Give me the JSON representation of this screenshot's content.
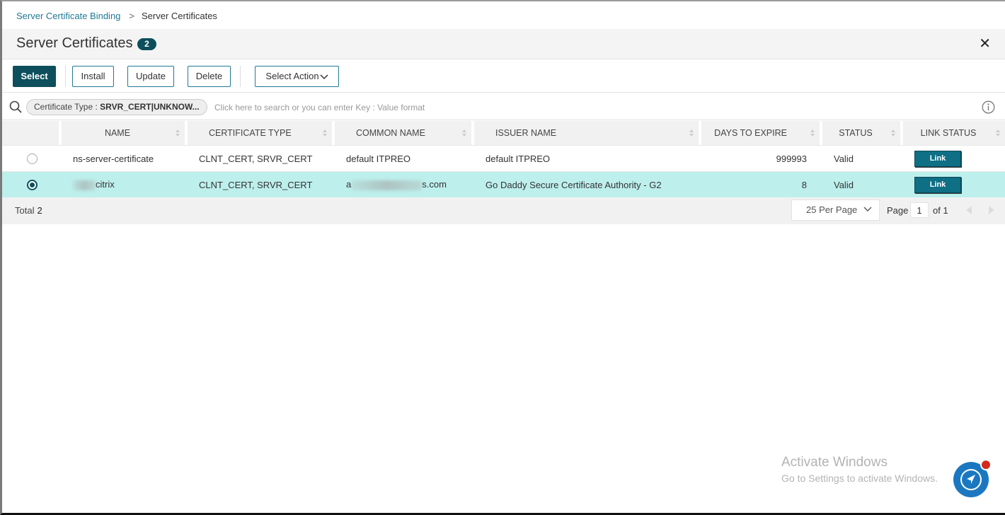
{
  "breadcrumb": {
    "parent": "Server Certificate Binding",
    "current": "Server Certificates"
  },
  "header": {
    "title": "Server Certificates",
    "count": "2",
    "close_icon": "close-icon"
  },
  "toolbar": {
    "select_label": "Select",
    "install_label": "Install",
    "update_label": "Update",
    "delete_label": "Delete",
    "select_action_label": "Select Action"
  },
  "search": {
    "chip_key": "Certificate Type : ",
    "chip_value": "SRVR_CERT|UNKNOW...",
    "placeholder": "Click here to search or you can enter Key : Value format"
  },
  "table": {
    "columns": [
      "",
      "NAME",
      "CERTIFICATE TYPE",
      "COMMON NAME",
      "ISSUER NAME",
      "DAYS TO EXPIRE",
      "STATUS",
      "LINK STATUS"
    ],
    "rows": [
      {
        "selected": false,
        "name": "ns-server-certificate",
        "name_redacted": false,
        "certificate_type": "CLNT_CERT, SRVR_CERT",
        "common_name": "default ITPREO",
        "issuer_name": "default ITPREO",
        "days_to_expire": "999993",
        "status": "Valid",
        "link_label": "Link"
      },
      {
        "selected": true,
        "name_suffix": "citrix",
        "common_name_prefix": "a",
        "common_name_suffix": "s.com",
        "certificate_type": "CLNT_CERT, SRVR_CERT",
        "issuer_name": "Go Daddy Secure Certificate Authority - G2",
        "days_to_expire": "8",
        "status": "Valid",
        "link_label": "Link"
      }
    ]
  },
  "footer": {
    "total_label": "Total",
    "total_value": "2",
    "per_page": "25 Per Page",
    "page_label": "Page",
    "page_value": "1",
    "page_of": "of 1"
  },
  "watermark": {
    "line1": "Activate Windows",
    "line2": "Go to Settings to activate Windows."
  },
  "colors": {
    "accent": "#0d4f5c",
    "link_text": "#1f7a94",
    "selected_row": "#bdefec",
    "link_button": "#0e6f85",
    "fab": "#1b78c0",
    "notification_dot": "#d42a1c"
  }
}
